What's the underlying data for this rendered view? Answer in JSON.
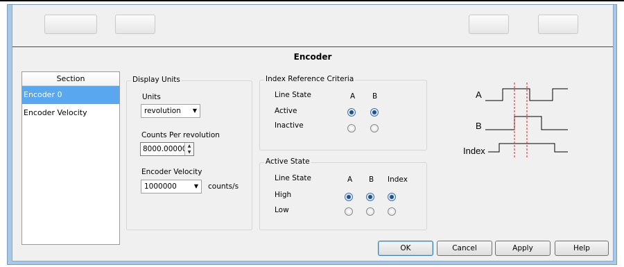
{
  "title": "Encoder",
  "section": {
    "header": "Section",
    "items": [
      "Encoder 0",
      "Encoder Velocity"
    ],
    "selected_index": 0
  },
  "display_units": {
    "group_label": "Display Units",
    "units_label": "Units",
    "units_value": "revolution",
    "counts_label": "Counts Per revolution",
    "counts_value": "8000.000000",
    "velocity_label": "Encoder Velocity",
    "velocity_value": "1000000",
    "velocity_unit": "counts/s"
  },
  "index_reference": {
    "group_label": "Index Reference Criteria",
    "line_state_label": "Line State",
    "col_a": "A",
    "col_b": "B",
    "row_active": "Active",
    "row_inactive": "Inactive",
    "selected": {
      "A": "Active",
      "B": "Active"
    }
  },
  "active_state": {
    "group_label": "Active State",
    "line_state_label": "Line State",
    "col_a": "A",
    "col_b": "B",
    "col_index": "Index",
    "row_high": "High",
    "row_low": "Low",
    "selected": {
      "A": "High",
      "B": "High",
      "Index": "High"
    }
  },
  "diagram": {
    "label_a": "A",
    "label_b": "B",
    "label_index": "Index"
  },
  "buttons": {
    "ok": "OK",
    "cancel": "Cancel",
    "apply": "Apply",
    "help": "Help"
  }
}
